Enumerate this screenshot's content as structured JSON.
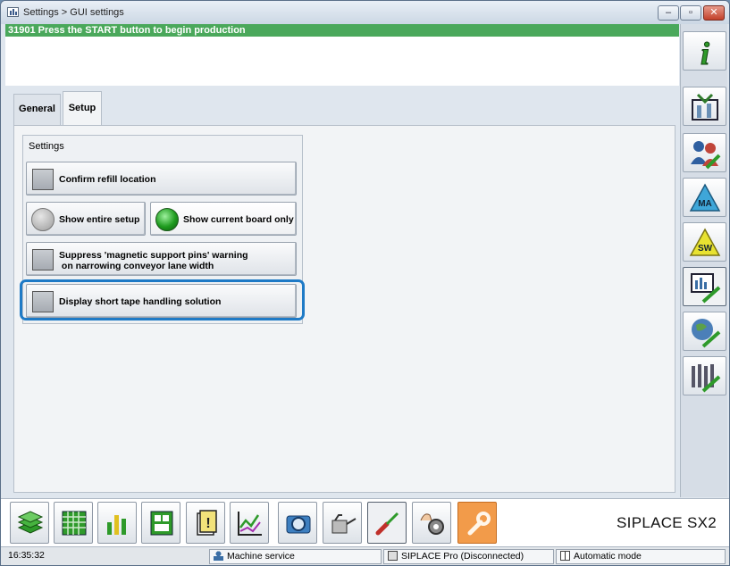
{
  "window": {
    "title": "Settings > GUI settings",
    "min_glyph": "‒",
    "max_glyph": "▫",
    "close_glyph": "✕"
  },
  "status_message": "31901 Press the START button to begin production",
  "tabs": [
    {
      "label": "General",
      "active": false
    },
    {
      "label": "Setup",
      "active": true
    }
  ],
  "settings": {
    "group_title": "Settings",
    "confirm_refill": {
      "label": "Confirm refill location",
      "checked": false
    },
    "show_entire_setup": {
      "label": "Show entire setup",
      "selected": false
    },
    "show_current_board": {
      "label": "Show current board only",
      "selected": true
    },
    "suppress_warning": {
      "line1": "Suppress 'magnetic support pins' warning",
      "line2": " on narrowing conveyor lane width",
      "checked": false
    },
    "short_tape": {
      "label": "Display short tape handling solution",
      "checked": false
    }
  },
  "right_toolbar": [
    {
      "icon": "info-icon"
    },
    {
      "icon": "station-setup-icon"
    },
    {
      "icon": "users-tool-icon"
    },
    {
      "icon": "ma-triangle-icon"
    },
    {
      "icon": "sw-triangle-icon"
    },
    {
      "icon": "gui-settings-monitor-icon",
      "active": true
    },
    {
      "icon": "globe-tool-icon"
    },
    {
      "icon": "feeder-tool-icon"
    }
  ],
  "bottom_toolbar": [
    {
      "icon": "stacks-icon"
    },
    {
      "icon": "grid-icon"
    },
    {
      "icon": "bar-chart-icon"
    },
    {
      "icon": "board-layout-icon"
    },
    {
      "icon": "warning-document-icon"
    },
    {
      "icon": "line-chart-icon"
    },
    {
      "icon": "camera-icon"
    },
    {
      "icon": "oil-can-icon"
    },
    {
      "icon": "screwdriver-icon",
      "active": true
    },
    {
      "icon": "hand-gear-icon"
    },
    {
      "icon": "wrench-icon",
      "highlight": true
    }
  ],
  "brand": "SIPLACE SX2",
  "statusbar": {
    "time": "16:35:32",
    "mode_user": "Machine service",
    "connection": "SIPLACE Pro (Disconnected)",
    "operation_mode": "Automatic mode"
  },
  "colors": {
    "status_green": "#4aa85b",
    "focus_blue": "#1e7ac6",
    "wrench_orange": "#f29b4a"
  }
}
